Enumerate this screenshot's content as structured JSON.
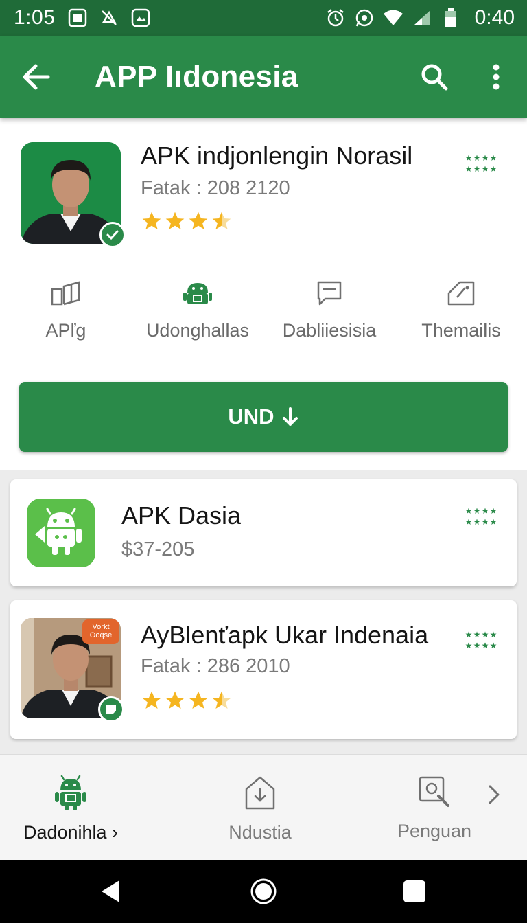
{
  "status_bar": {
    "time_left": "1:05",
    "time_right": "0:40"
  },
  "app_bar": {
    "title": "APP Iıdonesia",
    "icons": [
      "back-arrow-icon",
      "search-icon",
      "more-vert-icon"
    ]
  },
  "detail": {
    "title": "APK indjonlengin Norasil",
    "subtitle": "Fatak : 208 2120",
    "rating": 3.5,
    "features": [
      {
        "label": "APľg",
        "icon": "compare-icon"
      },
      {
        "label": "Udonghallas",
        "icon": "android-icon"
      },
      {
        "label": "Dabliiesisia",
        "icon": "comment-icon"
      },
      {
        "label": "Themailis",
        "icon": "tag-icon"
      }
    ],
    "install_label": "UND"
  },
  "list": [
    {
      "title": "APK Dasia",
      "subtitle": "$37-205"
    },
    {
      "title": "AyBlenťapk Ukar Indenaia",
      "subtitle": "Fatak : 286 2010",
      "rating": 3.5,
      "badge": "Vorkt Ooqse"
    }
  ],
  "bottom_nav": {
    "items": [
      {
        "label": "Dadonihla",
        "icon": "android-icon",
        "active": true
      },
      {
        "label": "Ndustia",
        "icon": "download-icon",
        "active": false
      },
      {
        "label": "Penguan",
        "icon": "search-image-icon",
        "active": false
      }
    ]
  },
  "colors": {
    "status_bar": "#1f6b38",
    "primary": "#2a8a49",
    "star": "#f5b520"
  }
}
